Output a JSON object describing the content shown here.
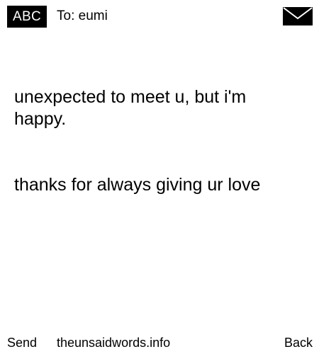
{
  "header": {
    "mode": "ABC",
    "recipient": "To: eumi",
    "icon": "envelope-icon"
  },
  "message": {
    "lines": [
      "unexpected to meet u, but i'm happy.",
      "thanks for always giving ur love"
    ]
  },
  "footer": {
    "left_softkey": "Send",
    "site": "theunsaidwords.info",
    "right_softkey": "Back"
  },
  "colors": {
    "background": "#ffffff",
    "text": "#000000",
    "badge_bg": "#000000",
    "badge_text": "#ffffff"
  }
}
